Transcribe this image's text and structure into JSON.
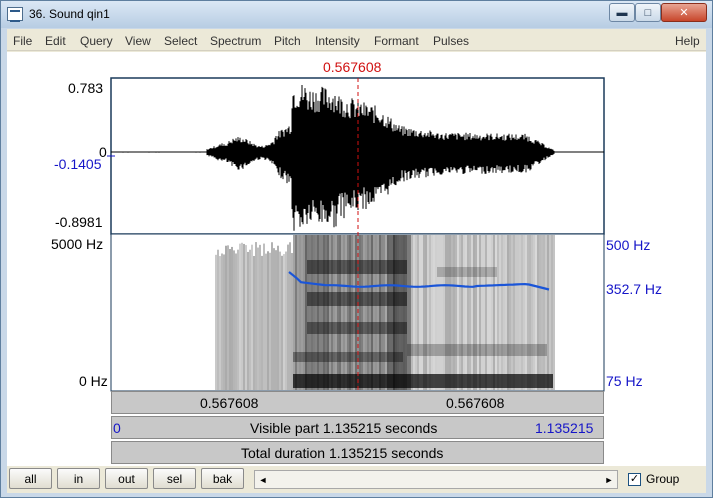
{
  "window": {
    "title": "36. Sound qin1",
    "buttons": {
      "minimize": "▬",
      "maximize": "□",
      "close": "✕"
    }
  },
  "menu": {
    "items": [
      "File",
      "Edit",
      "Query",
      "View",
      "Select",
      "Spectrum",
      "Pitch",
      "Intensity",
      "Formant",
      "Pulses"
    ],
    "help": "Help"
  },
  "cursor": {
    "time": "0.567608"
  },
  "waveform": {
    "max": "0.783",
    "zero": "0",
    "cursor_value": "-0.1405",
    "min": "-0.8981"
  },
  "spectrogram": {
    "freq_top": "5000 Hz",
    "freq_bottom": "0 Hz",
    "pitch_top": "500 Hz",
    "pitch_value": "352.7 Hz",
    "pitch_bottom": "75 Hz"
  },
  "time_bars": {
    "left_segment": "0.567608",
    "right_segment": "0.567608",
    "visible_start": "0",
    "visible_text": "Visible part 1.135215 seconds",
    "visible_end": "1.135215",
    "total_text": "Total duration 1.135215 seconds"
  },
  "toolbar": {
    "buttons": [
      "all",
      "in",
      "out",
      "sel",
      "bak"
    ],
    "scroll_left": "◄",
    "scroll_right": "►",
    "group_checked": "✓",
    "group_label": "Group"
  },
  "colors": {
    "cursor": "#d01010",
    "pitch_line": "#1a55d8",
    "axis_blue": "#1515c8"
  }
}
